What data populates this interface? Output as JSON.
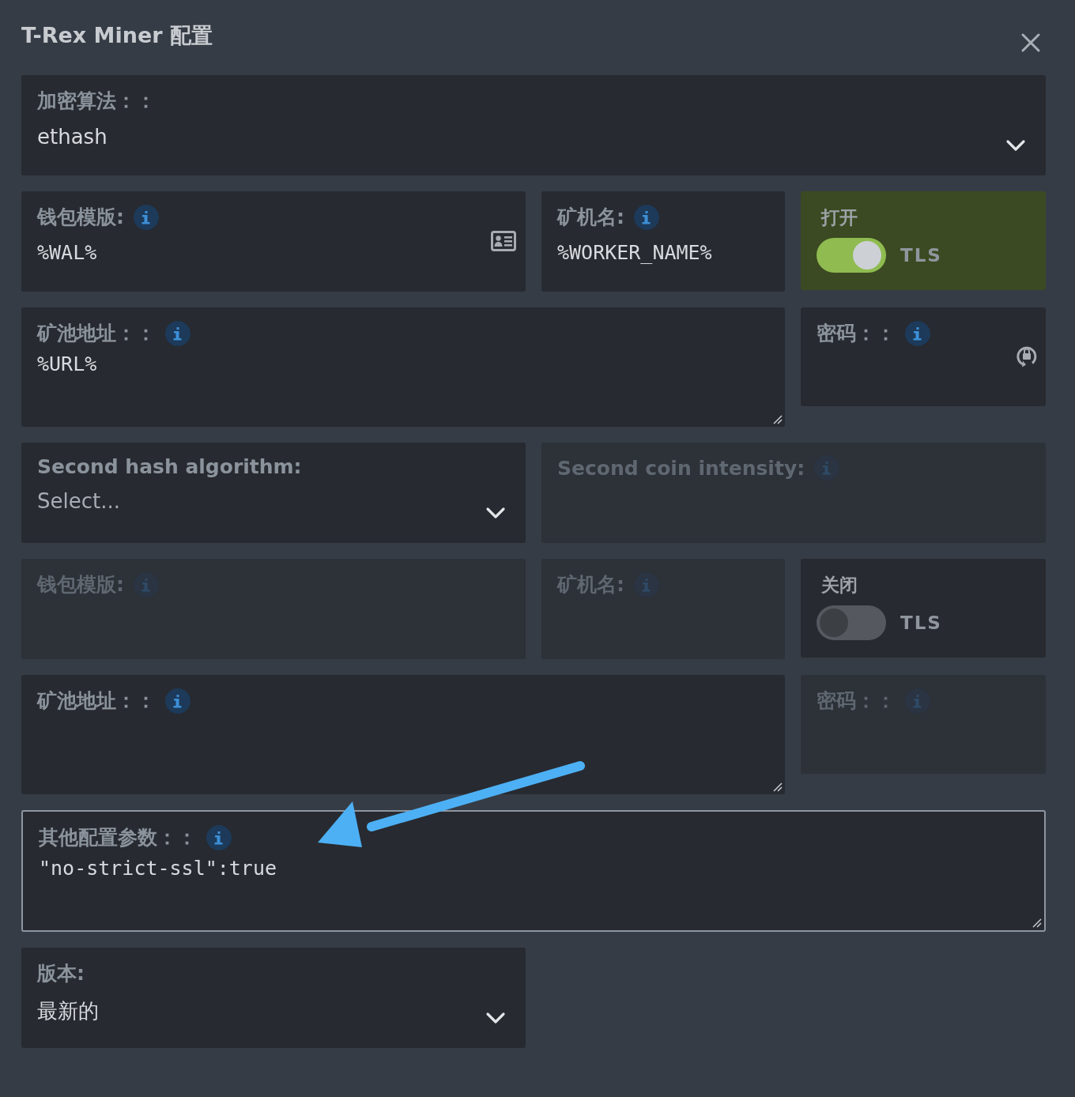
{
  "dialog": {
    "title": "T-Rex Miner 配置"
  },
  "rows": [
    {
      "fields": [
        {
          "kind": "select",
          "label": "加密算法：：",
          "value": "ethash",
          "disabled": false
        }
      ]
    },
    {
      "fields": [
        {
          "kind": "text",
          "label": "钱包模版:",
          "info": true,
          "value": "%WAL%",
          "card_icon": true,
          "disabled": false
        },
        {
          "kind": "text",
          "label": "矿机名:",
          "info": true,
          "value": "%WORKER_NAME%",
          "disabled": false
        },
        {
          "kind": "toggle",
          "status": "打开",
          "label": "TLS",
          "on": true
        }
      ]
    },
    {
      "fields": [
        {
          "kind": "textarea",
          "label": "矿池地址：：",
          "info": true,
          "value": "%URL%",
          "disabled": false,
          "focused": false
        },
        {
          "kind": "password",
          "label": "密码：：",
          "info": true,
          "disabled": false
        }
      ]
    },
    {
      "fields": [
        {
          "kind": "select",
          "label": "Second hash algorithm:",
          "placeholder": "Select...",
          "disabled": false
        },
        {
          "kind": "text",
          "label": "Second coin intensity:",
          "info": true,
          "disabled": true
        }
      ]
    },
    {
      "fields": [
        {
          "kind": "text",
          "label": "钱包模版:",
          "info": true,
          "disabled": true
        },
        {
          "kind": "text",
          "label": "矿机名:",
          "info": true,
          "disabled": true
        },
        {
          "kind": "toggle",
          "status": "关闭",
          "label": "TLS",
          "on": false
        }
      ]
    },
    {
      "fields": [
        {
          "kind": "textarea",
          "label": "矿池地址：：",
          "info": true,
          "disabled": false,
          "focused": false
        },
        {
          "kind": "password",
          "label": "密码：：",
          "info": true,
          "disabled": true
        }
      ]
    },
    {
      "fields": [
        {
          "kind": "textarea",
          "label": "其他配置参数：：",
          "info": true,
          "value": "\"no-strict-ssl\":true",
          "disabled": false,
          "focused": true
        }
      ]
    }
  ],
  "footer_field": {
    "kind": "select",
    "label": "版本:",
    "value": "最新的",
    "disabled": false
  },
  "annotations": [
    {
      "kind": "arrow"
    }
  ]
}
